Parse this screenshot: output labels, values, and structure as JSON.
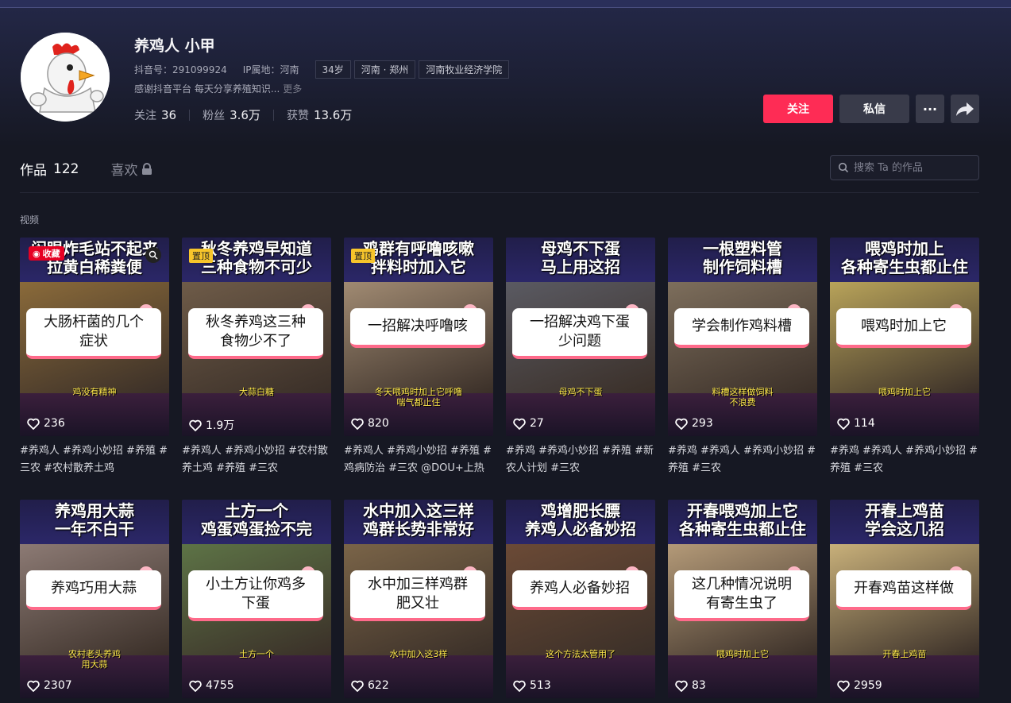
{
  "profile": {
    "name": "养鸡人 小甲",
    "douyin_id": "抖音号：291099924",
    "ip": "IP属地：河南",
    "tags": [
      "34岁",
      "河南 · 郑州",
      "河南牧业经济学院"
    ],
    "bio": "感谢抖音平台 每天分享养殖知识...",
    "bio_more": "更多",
    "stats": [
      {
        "label": "关注",
        "value": "36"
      },
      {
        "label": "粉丝",
        "value": "3.6万"
      },
      {
        "label": "获赞",
        "value": "13.6万"
      }
    ]
  },
  "actions": {
    "follow": "关注",
    "message": "私信",
    "more": "···"
  },
  "tabs": [
    {
      "label": "作品",
      "count": "122"
    },
    {
      "label": "喜欢"
    }
  ],
  "search": {
    "placeholder": "搜索 Ta 的作品"
  },
  "section_label": "视频",
  "badges": {
    "save": "收藏",
    "pinned": "置顶"
  },
  "videos": [
    {
      "title": "闷眼炸毛站不起来\n拉黄白稀粪便",
      "overlay": "大肠杆菌的几个\n症状",
      "subtitle": "鸡没有精神",
      "likes": "236",
      "desc": "#养鸡人 #养鸡小妙招 #养殖 #三农 #农村散养土鸡",
      "photo": "#8a6a3a"
    },
    {
      "title": "秋冬养鸡早知道\n三种食物不可少",
      "overlay": "秋冬养鸡这三种\n食物少不了",
      "subtitle": "大蒜白糖",
      "likes": "1.9万",
      "desc": "#养鸡人 #养鸡小妙招 #农村散养土鸡 #养殖 #三农",
      "photo": "#6e5b48"
    },
    {
      "title": "鸡群有呼噜咳嗽\n拌料时加入它",
      "overlay": "一招解决呼噜咳",
      "subtitle": "冬天喂鸡时加上它呼噜\n喘气都止住",
      "likes": "820",
      "desc": "#养鸡人 #养鸡小妙招 #养殖 #鸡病防治 #三农 @DOU+上热门",
      "photo": "#a08a72"
    },
    {
      "title": "母鸡不下蛋\n马上用这招",
      "overlay": "一招解决鸡下蛋\n少问题",
      "subtitle": "母鸡不下蛋",
      "likes": "27",
      "desc": "#养鸡 #养鸡小妙招 #养殖 #新农人计划 #三农",
      "photo": "#5a5a62"
    },
    {
      "title": "一根塑料管\n制作饲料槽",
      "overlay": "学会制作鸡料槽",
      "subtitle": "料槽这样做饲料\n不浪费",
      "likes": "293",
      "desc": "#养鸡 #养鸡人 #养鸡小妙招 #养殖 #三农",
      "photo": "#7d6e5c"
    },
    {
      "title": "喂鸡时加上\n各种寄生虫都止住",
      "overlay": "喂鸡时加上它",
      "subtitle": "喂鸡时加上它",
      "likes": "114",
      "desc": "#养鸡 #养鸡人 #养鸡小妙招 #养殖 #三农",
      "photo": "#b8a35a"
    },
    {
      "title": "养鸡用大蒜\n一年不白干",
      "overlay": "养鸡巧用大蒜",
      "subtitle": "农村老头养鸡\n用大蒜",
      "likes": "2307",
      "desc": "",
      "photo": "#8c7a74"
    },
    {
      "title": "土方一个\n鸡蛋鸡蛋捡不完",
      "overlay": "小土方让你鸡多\n下蛋",
      "subtitle": "土方一个",
      "likes": "4755",
      "desc": "",
      "photo": "#5d7346"
    },
    {
      "title": "水中加入这三样\n鸡群长势非常好",
      "overlay": "水中加三样鸡群\n肥又壮",
      "subtitle": "水中加入这3样",
      "likes": "622",
      "desc": "",
      "photo": "#7a6448"
    },
    {
      "title": "鸡增肥长膘\n养鸡人必备妙招",
      "overlay": "养鸡人必备妙招",
      "subtitle": "这个方法太管用了",
      "likes": "513",
      "desc": "",
      "photo": "#6b4a36"
    },
    {
      "title": "开春喂鸡加上它\n各种寄生虫都止住",
      "overlay": "这几种情况说明\n有寄生虫了",
      "subtitle": "喂鸡时加上它",
      "likes": "83",
      "desc": "",
      "photo": "#b49a78"
    },
    {
      "title": "开春上鸡苗\n学会这几招",
      "overlay": "开春鸡苗这样做",
      "subtitle": "开春上鸡苗",
      "likes": "2959",
      "desc": "",
      "photo": "#c8b07a"
    }
  ]
}
